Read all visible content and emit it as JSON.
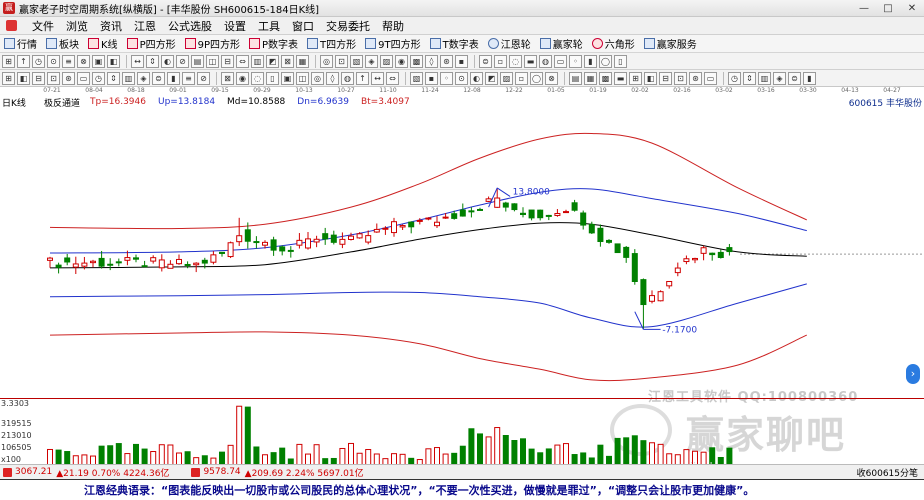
{
  "window": {
    "title": "赢家老子时空周期系统[纵横版] - [丰华股份  SH600615-184日K线]"
  },
  "menu": [
    "文件",
    "浏览",
    "资讯",
    "江恩",
    "公式选股",
    "设置",
    "工具",
    "窗口",
    "交易委托",
    "帮助"
  ],
  "toolbar1": [
    "行情",
    "板块",
    "K线",
    "P四方形",
    "9P四方形",
    "P数字表",
    "T四方形",
    "9T四方形",
    "T数字表",
    "江恩轮",
    "赢家轮",
    "六角形",
    "赢家服务"
  ],
  "dates": [
    "07-21",
    "08-04",
    "08-18",
    "09-01",
    "09-15",
    "09-29",
    "10-13",
    "10-27",
    "11-10",
    "11-24",
    "12-08",
    "12-22",
    "01-05",
    "01-19",
    "02-02",
    "02-16",
    "03-02",
    "03-16",
    "03-30",
    "04-13",
    "04-27"
  ],
  "indicator": {
    "period": "日K线",
    "name": "极反通道",
    "tp": "Tp=16.3946",
    "up": "Up=13.8184",
    "md": "Md=10.8588",
    "dn": "Dn=6.9639",
    "bt": "Bt=3.4097",
    "stock": "600615  丰华股份"
  },
  "annotations": {
    "high": "13.8000",
    "low": "7.1700"
  },
  "volume_axis": [
    "3.3303",
    "319515",
    "213010",
    "106505",
    "x100"
  ],
  "watermark": {
    "line": "江恩工具软件  QQ:100800360",
    "logo": "赢家聊吧",
    "url": "iiaoba.v..."
  },
  "status": {
    "idx1": "3067.21",
    "idx1_chg": "▲21.19  0.70%  4224.36亿",
    "idx2": "9578.74",
    "idx2_chg": "▲209.69  2.24%  5697.01亿",
    "right": "收600615分笔"
  },
  "banner": "江恩经典语录：“图表能反映出一切股市或公司股民的总体心理状况”，“不要一次性买进，做慢就是罪过”，“调整只会让股市更加健康”。",
  "colors": {
    "up": "#d00000",
    "down": "#008000",
    "outer_band": "#cc2222",
    "inner_band": "#2233cc",
    "mid_line": "#000000"
  },
  "chart_data": {
    "type": "candlestick",
    "price_range": [
      4.0,
      17.5
    ],
    "bands": {
      "outer_upper": [
        [
          0,
          11.95
        ],
        [
          15,
          11.9
        ],
        [
          25,
          12.1
        ],
        [
          35,
          12.9
        ],
        [
          43,
          14.0
        ],
        [
          50,
          15.2
        ],
        [
          57,
          16.1
        ],
        [
          63,
          16.35
        ],
        [
          70,
          15.9
        ],
        [
          80,
          13.8
        ],
        [
          88,
          12.3
        ]
      ],
      "inner_upper": [
        [
          0,
          10.75
        ],
        [
          15,
          10.8
        ],
        [
          25,
          11.0
        ],
        [
          35,
          11.6
        ],
        [
          43,
          12.3
        ],
        [
          50,
          13.0
        ],
        [
          57,
          13.6
        ],
        [
          63,
          13.75
        ],
        [
          70,
          13.3
        ],
        [
          80,
          12.6
        ],
        [
          88,
          11.8
        ]
      ],
      "mid": [
        [
          0,
          10.05
        ],
        [
          15,
          10.1
        ],
        [
          25,
          10.2
        ],
        [
          35,
          10.8
        ],
        [
          43,
          11.4
        ],
        [
          50,
          11.85
        ],
        [
          57,
          12.15
        ],
        [
          63,
          12.1
        ],
        [
          70,
          11.6
        ],
        [
          80,
          10.8
        ],
        [
          88,
          10.6
        ]
      ],
      "inner_lower": [
        [
          0,
          8.7
        ],
        [
          15,
          8.75
        ],
        [
          25,
          8.8
        ],
        [
          35,
          8.9
        ],
        [
          43,
          8.9
        ],
        [
          50,
          8.7
        ],
        [
          57,
          8.4
        ],
        [
          63,
          7.7
        ],
        [
          70,
          7.3
        ],
        [
          80,
          8.4
        ],
        [
          88,
          9.3
        ]
      ],
      "outer_lower": [
        [
          0,
          6.9
        ],
        [
          15,
          7.0
        ],
        [
          25,
          7.05
        ],
        [
          35,
          6.9
        ],
        [
          43,
          6.5
        ],
        [
          50,
          5.8
        ],
        [
          57,
          5.3
        ],
        [
          63,
          4.8
        ],
        [
          70,
          4.9
        ],
        [
          80,
          5.5
        ],
        [
          88,
          6.9
        ]
      ]
    },
    "close_sample": [
      [
        0,
        10.3
      ],
      [
        11,
        10.3
      ],
      [
        17,
        10.2
      ],
      [
        20,
        10.7
      ],
      [
        22,
        11.6
      ],
      [
        28,
        10.9
      ],
      [
        31,
        11.5
      ],
      [
        35,
        11.3
      ],
      [
        40,
        12.0
      ],
      [
        45,
        12.3
      ],
      [
        49,
        12.8
      ],
      [
        52,
        13.3
      ],
      [
        54,
        12.6
      ],
      [
        57,
        12.5
      ],
      [
        60,
        12.9
      ],
      [
        62,
        12.3
      ],
      [
        64,
        11.5
      ],
      [
        67,
        10.6
      ],
      [
        69,
        8.4
      ],
      [
        71,
        9.1
      ],
      [
        73,
        10.2
      ],
      [
        76,
        10.9
      ],
      [
        79,
        10.7
      ]
    ],
    "volume_range": [
      0,
      330000
    ]
  }
}
